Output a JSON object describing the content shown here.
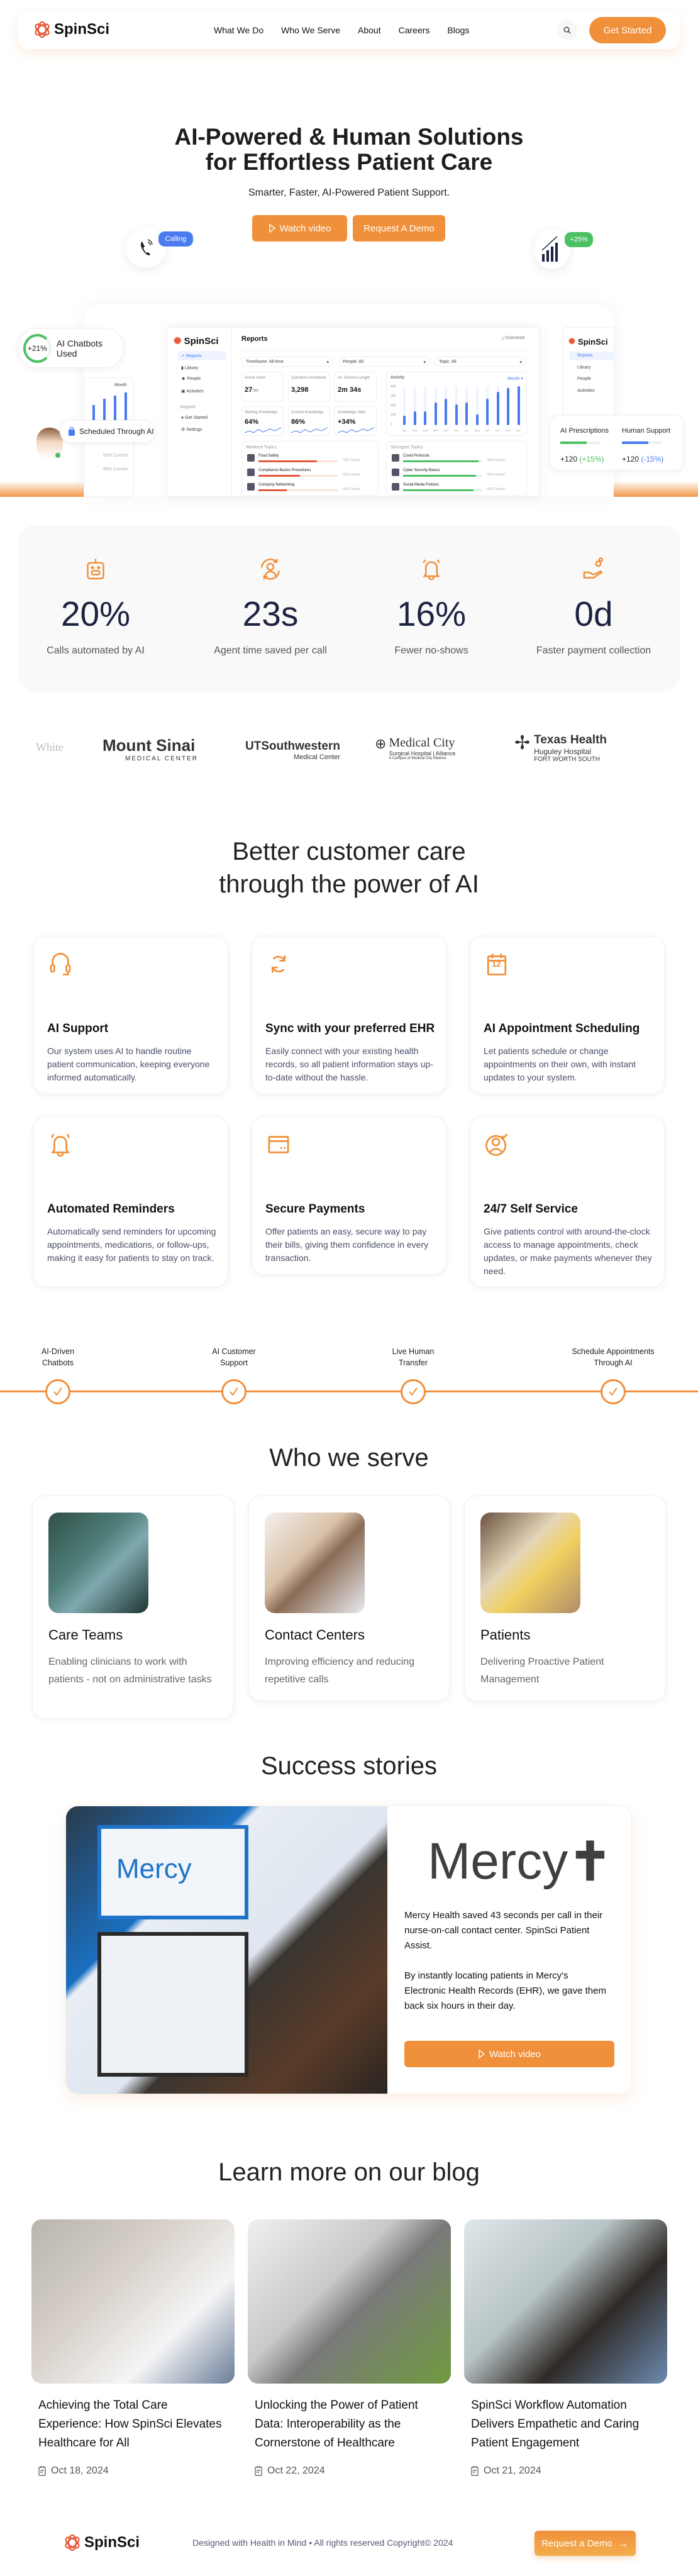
{
  "nav": {
    "logo": "SpinSci",
    "links": [
      "What We Do",
      "Who We Serve",
      "About",
      "Careers",
      "Blogs"
    ],
    "get_started": "Get Started"
  },
  "hero": {
    "title_line1": "AI-Powered & Human Solutions",
    "title_line2": "for Effortless Patient Care",
    "subtitle": "Smarter, Faster, AI-Powered Patient Support.",
    "watch_video": "Watch video",
    "request_demo": "Request A Demo",
    "calling_badge": "Calling",
    "growth_badge": "+25%"
  },
  "dashboard": {
    "chatbots_pct": "+21%",
    "chatbots_label": "AI Chatbots Used",
    "scheduled_label": "Scheduled Through AI",
    "logo": "SpinSci",
    "menu": [
      "Reports",
      "Library",
      "People",
      "Activities"
    ],
    "support_heading": "Support",
    "support_menu": [
      "Get Started",
      "Settings"
    ],
    "title": "Reports",
    "download": "Download",
    "filters": [
      "Timeframe: All-time",
      "People: All",
      "Topic: All"
    ],
    "stats": [
      {
        "label": "Active Users",
        "value": "27",
        "suffix": "/80"
      },
      {
        "label": "Questions Answered",
        "value": "3,298",
        "suffix": ""
      },
      {
        "label": "Av. Session Length",
        "value": "2m 34s",
        "suffix": ""
      }
    ],
    "knowledge": [
      {
        "label": "Starting Knowledge",
        "value": "64%"
      },
      {
        "label": "Current Knowledge",
        "value": "86%"
      },
      {
        "label": "Knowledge Gain",
        "value": "+34%"
      }
    ],
    "activity": {
      "title": "Activity",
      "period": "Month",
      "y_ticks": [
        "400",
        "300",
        "200",
        "100",
        "0"
      ],
      "months": [
        "JAN",
        "FEB",
        "MAR",
        "APR",
        "MAY",
        "JUN",
        "JUL",
        "AUG",
        "SEP",
        "OCT",
        "NOV",
        "DEC"
      ],
      "values": [
        100,
        140,
        140,
        230,
        270,
        210,
        230,
        110,
        270,
        340,
        380,
        400
      ]
    },
    "weakest": {
      "title": "Weakest Topics",
      "items": [
        {
          "name": "Food Safety",
          "pct": "74% Correct",
          "fill": 74
        },
        {
          "name": "Compliance Basics Procedures",
          "pct": "52% Correct",
          "fill": 52
        },
        {
          "name": "Company Networking",
          "pct": "36% Correct",
          "fill": 36
        }
      ]
    },
    "strongest": {
      "title": "Strongest Topics",
      "items": [
        {
          "name": "Covid Protocols",
          "pct": "95% Correct",
          "fill": 95
        },
        {
          "name": "Cyber Security Basics",
          "pct": "92% Correct",
          "fill": 92
        },
        {
          "name": "Social Media Policies",
          "pct": "89% Correct",
          "fill": 89
        }
      ]
    },
    "back_card": {
      "period": "Month",
      "pcts": [
        "95% Correct",
        "92% Correct",
        "89% Correct"
      ]
    },
    "right_menu": [
      "Reports",
      "Library",
      "People",
      "Activities"
    ],
    "prescriptions": {
      "label": "AI Prescriptions",
      "value": "+120",
      "change": "(+15%)",
      "fill": 65
    },
    "human": {
      "label": "Human Support",
      "value": "+120",
      "change": "(-15%)",
      "fill": 65
    },
    "colors": {
      "blue": "#4A7CF0",
      "green": "#4CC063",
      "red": "#E8583A"
    }
  },
  "stats": [
    {
      "icon": "robot-icon",
      "value": "20%",
      "label": "Calls automated by AI"
    },
    {
      "icon": "agent-cycle-icon",
      "value": "23s",
      "label": "Agent time saved per call"
    },
    {
      "icon": "bell-icon",
      "value": "16%",
      "label": "Fewer no-shows"
    },
    {
      "icon": "hand-coins-icon",
      "value": "0d",
      "label": "Faster payment collection"
    }
  ],
  "logos": {
    "white": "White",
    "sinai": {
      "name": "Mount Sinai",
      "sub": "MEDICAL CENTER"
    },
    "ut": {
      "name": "UTSouthwestern",
      "sub": "Medical Center"
    },
    "medcity": {
      "name": "Medical City",
      "sub": "Surgical Hospital | Alliance",
      "sub2": "A Campus of Medical City Alliance"
    },
    "texas": {
      "name": "Texas Health",
      "sub": "Huguley Hospital",
      "sub2": "FORT WORTH SOUTH"
    }
  },
  "features": {
    "heading_line1": "Better customer care",
    "heading_line2": "through the power of AI",
    "cards": [
      {
        "icon": "headset-icon",
        "title": "AI Support",
        "desc": "Our system uses AI to handle routine patient communication, keeping everyone informed automatically."
      },
      {
        "icon": "sync-icon",
        "title": "Sync with your preferred EHR",
        "desc": "Easily connect with your existing health records, so all patient information stays up-to-date without the hassle."
      },
      {
        "icon": "calendar-icon",
        "title": "AI Appointment Scheduling",
        "desc": "Let patients schedule or change appointments on their own, with instant updates to your system."
      },
      {
        "icon": "bell-icon",
        "title": "Automated Reminders",
        "desc": "Automatically send reminders for upcoming appointments, medications, or follow-ups, making it easy for patients to stay on track."
      },
      {
        "icon": "payment-card-icon",
        "title": "Secure Payments",
        "desc": "Offer patients an easy, secure way to pay their bills, giving them confidence in every transaction."
      },
      {
        "icon": "user-check-icon",
        "title": "24/7 Self Service",
        "desc": "Give patients control with around-the-clock access to manage appointments, check updates, or make payments whenever they need."
      }
    ],
    "calendar_day": "12"
  },
  "timeline": [
    {
      "line1": "AI-Driven",
      "line2": "Chatbots"
    },
    {
      "line1": "AI Customer",
      "line2": "Support"
    },
    {
      "line1": "Live Human",
      "line2": "Transfer"
    },
    {
      "line1": "Schedule Appointments",
      "line2": "Through AI"
    }
  ],
  "who": {
    "heading": "Who we serve",
    "cards": [
      {
        "title": "Care Teams",
        "desc": "Enabling clinicians to work with patients - not on administrative tasks"
      },
      {
        "title": "Contact Centers",
        "desc": "Improving efficiency and reducing repetitive calls"
      },
      {
        "title": "Patients",
        "desc": "Delivering Proactive Patient Management"
      }
    ]
  },
  "success": {
    "heading": "Success stories",
    "logo": "Mercy",
    "para1": "Mercy Health saved 43 seconds per call in their nurse-on-call contact center. SpinSci Patient Assist.",
    "para2": "By instantly locating patients in Mercy's Electronic Health Records (EHR), we gave them back six hours in their day.",
    "button": "Watch video"
  },
  "blog": {
    "heading": "Learn more on our blog",
    "posts": [
      {
        "title": "Achieving the Total Care Experience: How SpinSci Elevates Healthcare for All",
        "date": "Oct 18, 2024"
      },
      {
        "title": "Unlocking the Power of Patient Data: Interoperability as the Cornerstone of Healthcare",
        "date": "Oct 22, 2024"
      },
      {
        "title": "SpinSci Workflow Automation Delivers Empathetic and Caring Patient Engagement",
        "date": "Oct 21, 2024"
      }
    ]
  },
  "footer": {
    "logo": "SpinSci",
    "text": "Designed with Health in Mind • All rights reserved Copyright© 2024",
    "button": "Request a Demo"
  },
  "colors": {
    "accent": "#F0903A",
    "number": "#1C2340"
  }
}
